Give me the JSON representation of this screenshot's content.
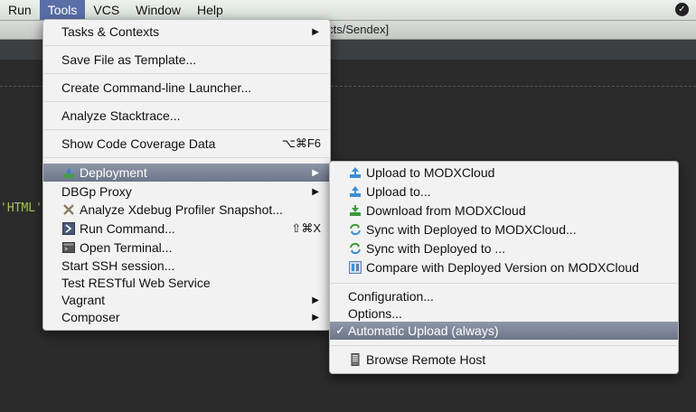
{
  "menubar": {
    "items": [
      "Run",
      "Tools",
      "VCS",
      "Window",
      "Help"
    ],
    "active": "Tools"
  },
  "window": {
    "title_fragment": "endex - [~/Projects/Sendex]"
  },
  "editor": {
    "code_fragment": "'HTML'"
  },
  "tools_menu": {
    "items": [
      {
        "label": "Tasks & Contexts",
        "submenu": true
      },
      {
        "label": "Save File as Template..."
      },
      {
        "label": "Create Command-line Launcher..."
      },
      {
        "label": "Analyze Stacktrace..."
      },
      {
        "label": "Show Code Coverage Data",
        "shortcut": "⌥⌘F6"
      },
      {
        "label": "Deployment",
        "submenu": true,
        "selected": true,
        "icon": "deployment-icon"
      },
      {
        "label": "DBGp Proxy",
        "submenu": true
      },
      {
        "label": "Analyze Xdebug Profiler Snapshot...",
        "icon": "xdebug-icon"
      },
      {
        "label": "Run Command...",
        "shortcut": "⇧⌘X",
        "icon": "run-command-icon"
      },
      {
        "label": "Open Terminal...",
        "icon": "terminal-icon"
      },
      {
        "label": "Start SSH session..."
      },
      {
        "label": "Test RESTful Web Service"
      },
      {
        "label": "Vagrant",
        "submenu": true
      },
      {
        "label": "Composer",
        "submenu": true
      }
    ]
  },
  "deployment_menu": {
    "items": [
      {
        "label": "Upload to MODXCloud",
        "icon": "upload-icon"
      },
      {
        "label": "Upload to...",
        "icon": "upload-icon"
      },
      {
        "label": "Download from MODXCloud",
        "icon": "download-icon"
      },
      {
        "label": "Sync with Deployed to MODXCloud...",
        "icon": "sync-icon"
      },
      {
        "label": "Sync with Deployed to ...",
        "icon": "sync-icon"
      },
      {
        "label": "Compare with Deployed Version on MODXCloud",
        "icon": "compare-icon"
      },
      {
        "label": "Configuration..."
      },
      {
        "label": "Options..."
      },
      {
        "label": "Automatic Upload (always)",
        "checked": true,
        "selected": true
      },
      {
        "label": "Browse Remote Host",
        "icon": "server-icon"
      }
    ]
  },
  "icons": {
    "arrow": "▶",
    "check": "✓"
  },
  "colors": {
    "selection": "#7a8396",
    "menu_bg": "#f2f2f2",
    "menubar_active": "#5a6ea8"
  }
}
